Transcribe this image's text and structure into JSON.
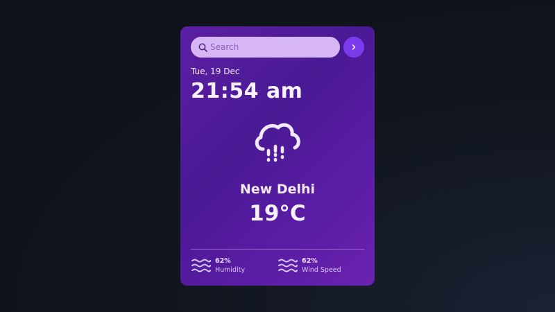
{
  "search": {
    "placeholder": "Search",
    "value": ""
  },
  "header": {
    "date": "Tue, 19 Dec",
    "time": "21:54 am"
  },
  "weather": {
    "icon": "cloud-rain-icon",
    "city": "New Delhi",
    "temperature": "19°C"
  },
  "stats": {
    "humidity": {
      "value": "62%",
      "label": "Humidity",
      "icon": "waves-icon"
    },
    "wind": {
      "value": "62%",
      "label": "Wind Speed",
      "icon": "waves-icon"
    }
  },
  "colors": {
    "card_gradient_start": "#5b1fa3",
    "card_gradient_end": "#6a22b0",
    "search_bg": "#d7b6f5",
    "accent_button": "#7c3aed",
    "text": "#f2e9ff",
    "page_bg": "#11161f"
  }
}
